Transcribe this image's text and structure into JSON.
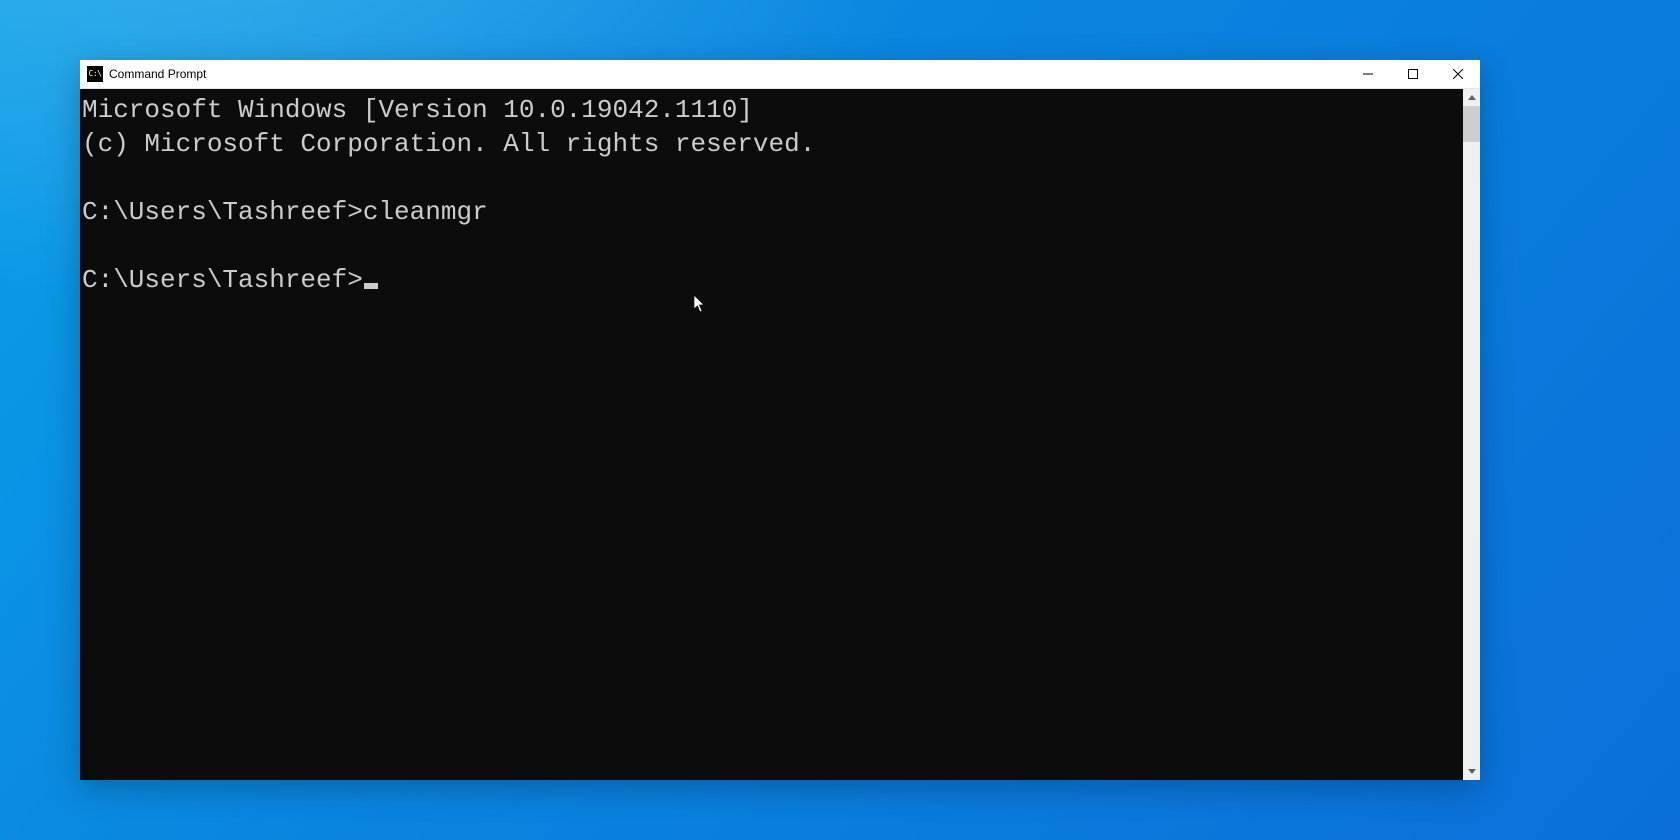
{
  "window": {
    "title": "Command Prompt"
  },
  "console": {
    "lines": [
      "Microsoft Windows [Version 10.0.19042.1110]",
      "(c) Microsoft Corporation. All rights reserved.",
      "",
      "C:\\Users\\Tashreef>cleanmgr",
      "",
      "C:\\Users\\Tashreef>"
    ]
  }
}
